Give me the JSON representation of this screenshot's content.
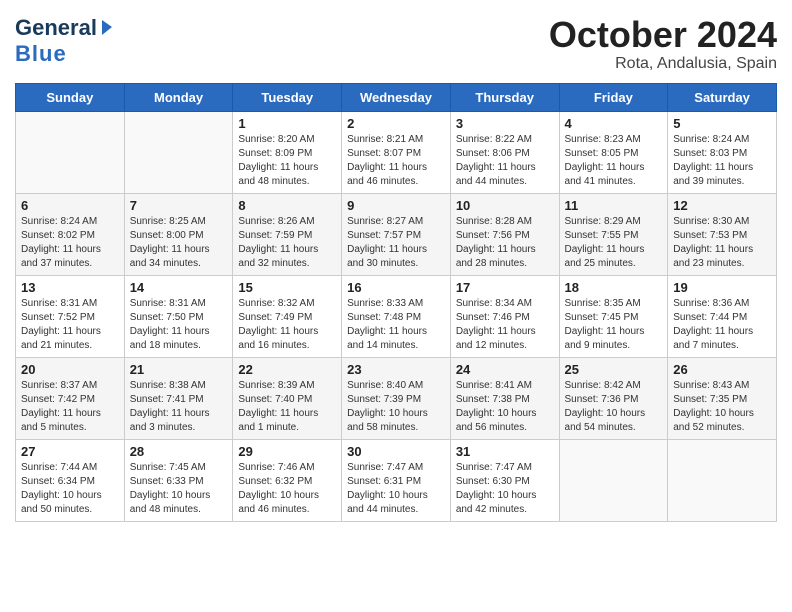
{
  "header": {
    "logo_general": "General",
    "logo_blue": "Blue",
    "month_title": "October 2024",
    "location": "Rota, Andalusia, Spain"
  },
  "days_of_week": [
    "Sunday",
    "Monday",
    "Tuesday",
    "Wednesday",
    "Thursday",
    "Friday",
    "Saturday"
  ],
  "weeks": [
    [
      null,
      null,
      {
        "day": "1",
        "sunrise": "Sunrise: 8:20 AM",
        "sunset": "Sunset: 8:09 PM",
        "daylight": "Daylight: 11 hours and 48 minutes."
      },
      {
        "day": "2",
        "sunrise": "Sunrise: 8:21 AM",
        "sunset": "Sunset: 8:07 PM",
        "daylight": "Daylight: 11 hours and 46 minutes."
      },
      {
        "day": "3",
        "sunrise": "Sunrise: 8:22 AM",
        "sunset": "Sunset: 8:06 PM",
        "daylight": "Daylight: 11 hours and 44 minutes."
      },
      {
        "day": "4",
        "sunrise": "Sunrise: 8:23 AM",
        "sunset": "Sunset: 8:05 PM",
        "daylight": "Daylight: 11 hours and 41 minutes."
      },
      {
        "day": "5",
        "sunrise": "Sunrise: 8:24 AM",
        "sunset": "Sunset: 8:03 PM",
        "daylight": "Daylight: 11 hours and 39 minutes."
      }
    ],
    [
      {
        "day": "6",
        "sunrise": "Sunrise: 8:24 AM",
        "sunset": "Sunset: 8:02 PM",
        "daylight": "Daylight: 11 hours and 37 minutes."
      },
      {
        "day": "7",
        "sunrise": "Sunrise: 8:25 AM",
        "sunset": "Sunset: 8:00 PM",
        "daylight": "Daylight: 11 hours and 34 minutes."
      },
      {
        "day": "8",
        "sunrise": "Sunrise: 8:26 AM",
        "sunset": "Sunset: 7:59 PM",
        "daylight": "Daylight: 11 hours and 32 minutes."
      },
      {
        "day": "9",
        "sunrise": "Sunrise: 8:27 AM",
        "sunset": "Sunset: 7:57 PM",
        "daylight": "Daylight: 11 hours and 30 minutes."
      },
      {
        "day": "10",
        "sunrise": "Sunrise: 8:28 AM",
        "sunset": "Sunset: 7:56 PM",
        "daylight": "Daylight: 11 hours and 28 minutes."
      },
      {
        "day": "11",
        "sunrise": "Sunrise: 8:29 AM",
        "sunset": "Sunset: 7:55 PM",
        "daylight": "Daylight: 11 hours and 25 minutes."
      },
      {
        "day": "12",
        "sunrise": "Sunrise: 8:30 AM",
        "sunset": "Sunset: 7:53 PM",
        "daylight": "Daylight: 11 hours and 23 minutes."
      }
    ],
    [
      {
        "day": "13",
        "sunrise": "Sunrise: 8:31 AM",
        "sunset": "Sunset: 7:52 PM",
        "daylight": "Daylight: 11 hours and 21 minutes."
      },
      {
        "day": "14",
        "sunrise": "Sunrise: 8:31 AM",
        "sunset": "Sunset: 7:50 PM",
        "daylight": "Daylight: 11 hours and 18 minutes."
      },
      {
        "day": "15",
        "sunrise": "Sunrise: 8:32 AM",
        "sunset": "Sunset: 7:49 PM",
        "daylight": "Daylight: 11 hours and 16 minutes."
      },
      {
        "day": "16",
        "sunrise": "Sunrise: 8:33 AM",
        "sunset": "Sunset: 7:48 PM",
        "daylight": "Daylight: 11 hours and 14 minutes."
      },
      {
        "day": "17",
        "sunrise": "Sunrise: 8:34 AM",
        "sunset": "Sunset: 7:46 PM",
        "daylight": "Daylight: 11 hours and 12 minutes."
      },
      {
        "day": "18",
        "sunrise": "Sunrise: 8:35 AM",
        "sunset": "Sunset: 7:45 PM",
        "daylight": "Daylight: 11 hours and 9 minutes."
      },
      {
        "day": "19",
        "sunrise": "Sunrise: 8:36 AM",
        "sunset": "Sunset: 7:44 PM",
        "daylight": "Daylight: 11 hours and 7 minutes."
      }
    ],
    [
      {
        "day": "20",
        "sunrise": "Sunrise: 8:37 AM",
        "sunset": "Sunset: 7:42 PM",
        "daylight": "Daylight: 11 hours and 5 minutes."
      },
      {
        "day": "21",
        "sunrise": "Sunrise: 8:38 AM",
        "sunset": "Sunset: 7:41 PM",
        "daylight": "Daylight: 11 hours and 3 minutes."
      },
      {
        "day": "22",
        "sunrise": "Sunrise: 8:39 AM",
        "sunset": "Sunset: 7:40 PM",
        "daylight": "Daylight: 11 hours and 1 minute."
      },
      {
        "day": "23",
        "sunrise": "Sunrise: 8:40 AM",
        "sunset": "Sunset: 7:39 PM",
        "daylight": "Daylight: 10 hours and 58 minutes."
      },
      {
        "day": "24",
        "sunrise": "Sunrise: 8:41 AM",
        "sunset": "Sunset: 7:38 PM",
        "daylight": "Daylight: 10 hours and 56 minutes."
      },
      {
        "day": "25",
        "sunrise": "Sunrise: 8:42 AM",
        "sunset": "Sunset: 7:36 PM",
        "daylight": "Daylight: 10 hours and 54 minutes."
      },
      {
        "day": "26",
        "sunrise": "Sunrise: 8:43 AM",
        "sunset": "Sunset: 7:35 PM",
        "daylight": "Daylight: 10 hours and 52 minutes."
      }
    ],
    [
      {
        "day": "27",
        "sunrise": "Sunrise: 7:44 AM",
        "sunset": "Sunset: 6:34 PM",
        "daylight": "Daylight: 10 hours and 50 minutes."
      },
      {
        "day": "28",
        "sunrise": "Sunrise: 7:45 AM",
        "sunset": "Sunset: 6:33 PM",
        "daylight": "Daylight: 10 hours and 48 minutes."
      },
      {
        "day": "29",
        "sunrise": "Sunrise: 7:46 AM",
        "sunset": "Sunset: 6:32 PM",
        "daylight": "Daylight: 10 hours and 46 minutes."
      },
      {
        "day": "30",
        "sunrise": "Sunrise: 7:47 AM",
        "sunset": "Sunset: 6:31 PM",
        "daylight": "Daylight: 10 hours and 44 minutes."
      },
      {
        "day": "31",
        "sunrise": "Sunrise: 7:47 AM",
        "sunset": "Sunset: 6:30 PM",
        "daylight": "Daylight: 10 hours and 42 minutes."
      },
      null,
      null
    ]
  ]
}
